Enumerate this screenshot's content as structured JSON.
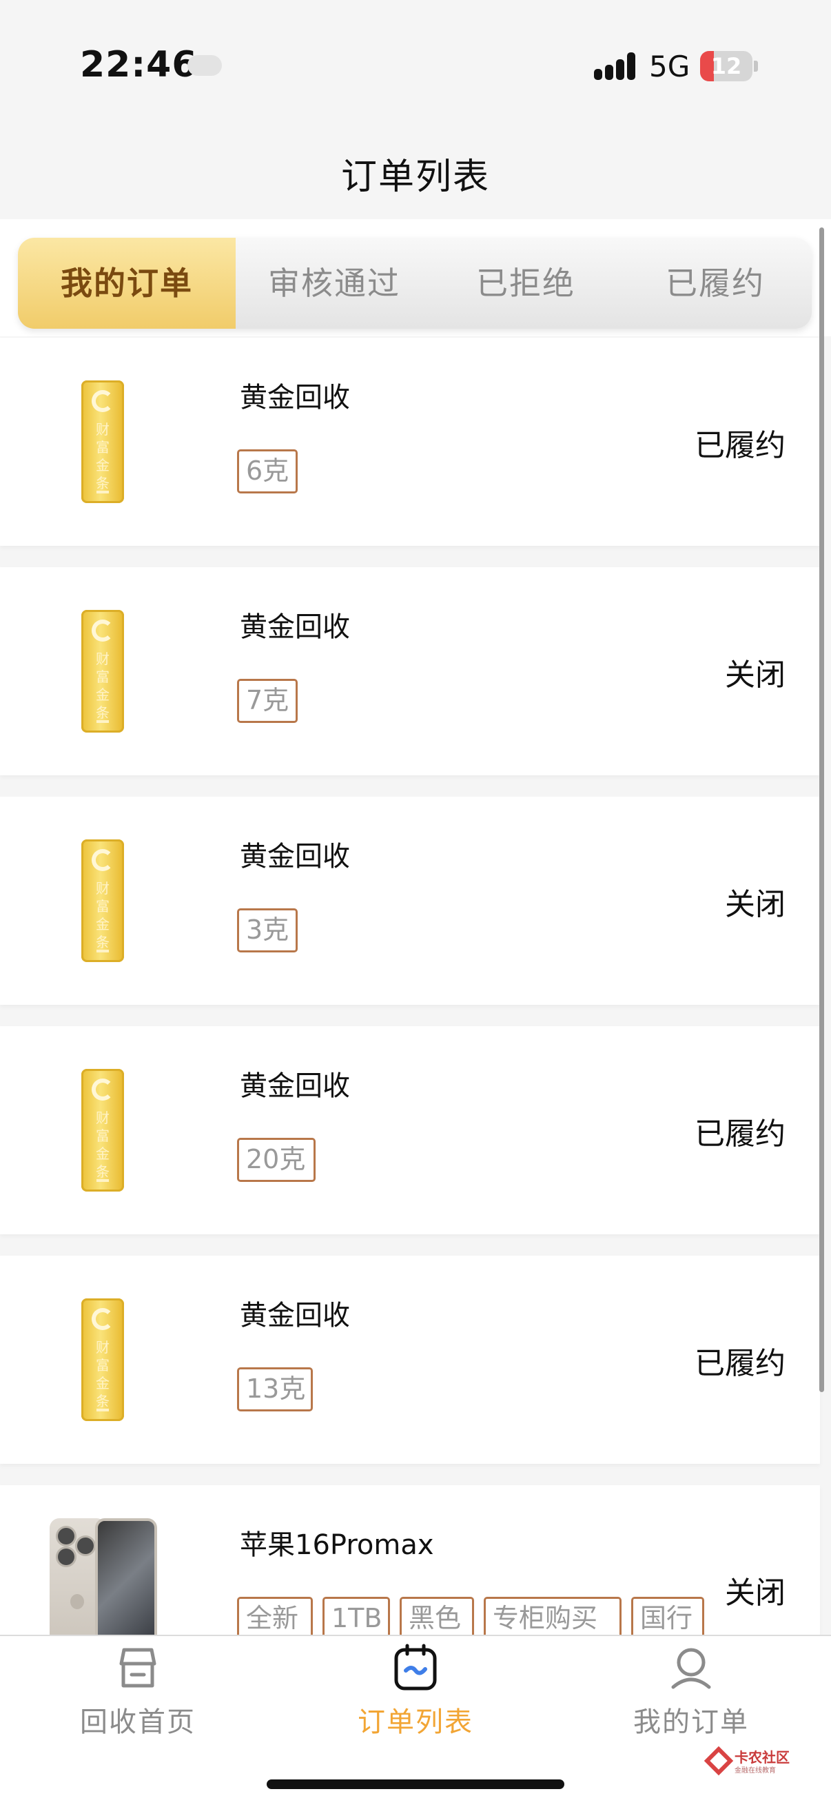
{
  "status_bar": {
    "time": "22:46",
    "network": "5G",
    "battery": "12",
    "signal_icon": "cellular-signal-icon"
  },
  "header": {
    "title": "订单列表"
  },
  "tabs": [
    {
      "label": "我的订单",
      "active": true
    },
    {
      "label": "审核通过",
      "active": false
    },
    {
      "label": "已拒绝",
      "active": false
    },
    {
      "label": "已履约",
      "active": false
    }
  ],
  "product_image": {
    "engraving": "财富金条"
  },
  "orders": [
    {
      "title": "黄金回收",
      "tags": [
        "6克"
      ],
      "status": "已履约",
      "image": "gold-bar"
    },
    {
      "title": "黄金回收",
      "tags": [
        "7克"
      ],
      "status": "关闭",
      "image": "gold-bar"
    },
    {
      "title": "黄金回收",
      "tags": [
        "3克"
      ],
      "status": "关闭",
      "image": "gold-bar"
    },
    {
      "title": "黄金回收",
      "tags": [
        "20克"
      ],
      "status": "已履约",
      "image": "gold-bar"
    },
    {
      "title": "黄金回收",
      "tags": [
        "13克"
      ],
      "status": "已履约",
      "image": "gold-bar"
    },
    {
      "title": "苹果16Promax",
      "tags": [
        "全新",
        "1TB",
        "黑色",
        "专柜购买",
        "国行"
      ],
      "status": "关闭",
      "image": "iphone"
    }
  ],
  "tabbar": {
    "items": [
      {
        "label": "回收首页",
        "icon": "store-icon",
        "active": false
      },
      {
        "label": "订单列表",
        "icon": "order-list-icon",
        "active": true
      },
      {
        "label": "我的订单",
        "icon": "user-icon",
        "active": false
      }
    ]
  },
  "watermark": {
    "name": "卡农社区",
    "subtitle": "金融在线教育"
  },
  "colors": {
    "accent": "#f2a534",
    "tab_active_bg": "#f1cc6a",
    "tag_border": "#b8774a",
    "gold": "#ecc138"
  }
}
